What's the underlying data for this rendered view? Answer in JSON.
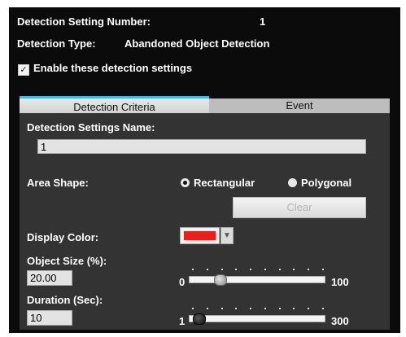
{
  "header": {
    "setting_number_label": "Detection Setting Number:",
    "setting_number_value": "1",
    "type_label": "Detection Type:",
    "type_value": "Abandoned Object Detection",
    "enable_label": "Enable these detection settings",
    "enable_checked": true
  },
  "tabs": [
    {
      "label": "Detection Criteria",
      "active": true
    },
    {
      "label": "Event",
      "active": false
    }
  ],
  "criteria": {
    "name_label": "Detection Settings Name:",
    "name_value": "1",
    "area_shape_label": "Area Shape:",
    "area_options": [
      {
        "label": "Rectangular",
        "selected": true
      },
      {
        "label": "Polygonal",
        "selected": false
      }
    ],
    "clear_label": "Clear",
    "display_color_label": "Display Color:",
    "display_color": "#e8201a",
    "object_size_label": "Object Size (%):",
    "object_size_value": "20.00",
    "object_size_min": "0",
    "object_size_max": "100",
    "object_size_fraction": 0.2,
    "duration_label": "Duration (Sec):",
    "duration_value": "10",
    "duration_min": "1",
    "duration_max": "300",
    "duration_fraction": 0.03
  },
  "icons": {
    "checkbox": "check-icon",
    "dropdown": "triangle-down-icon"
  }
}
